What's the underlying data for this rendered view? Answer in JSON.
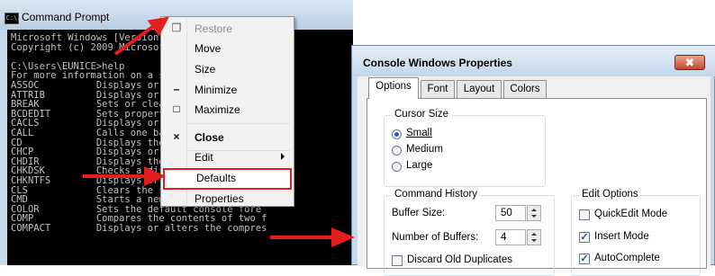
{
  "cmd": {
    "title": "Command Prompt",
    "icon": "cmd-icon",
    "lines": [
      "Microsoft Windows [Version 6.1.7600]",
      "Copyright (c) 2009 Microsoft Corporation.  Al",
      "",
      "C:\\Users\\EUNICE>help",
      "For more information on a specific command, t",
      "ASSOC          Displays or modifies file exte",
      "ATTRIB         Displays or changes file attri",
      "BREAK          Sets or clears extended CTRL+C",
      "BCDEDIT        Sets properties in boot databa",
      "CACLS          Displays or modifies access co",
      "CALL           Calls one batch program from a",
      "CD             Displays the name of or change",
      "CHCP           Displays or sets the active co",
      "CHDIR          Displays the name of or change",
      "CHKDSK         Checks a disk and displays a s",
      "CHKNTFS        Displays or modifies the check",
      "CLS            Clears the screen.",
      "CMD            Starts a new instance of the W",
      "COLOR          Sets the default console fore",
      "COMP           Compares the contents of two f",
      "COMPACT        Displays or alters the compres"
    ]
  },
  "context_menu": {
    "items": [
      {
        "label": "Restore",
        "icon": "restore-icon",
        "glyph": "❐",
        "disabled": true
      },
      {
        "label": "Move"
      },
      {
        "label": "Size"
      },
      {
        "label": "Minimize",
        "icon": "minimize-icon",
        "glyph": "–"
      },
      {
        "label": "Maximize",
        "icon": "maximize-icon",
        "glyph": "□"
      },
      {
        "label": "Close",
        "icon": "close-icon",
        "glyph": "×"
      },
      {
        "label": "Edit",
        "has_submenu": true
      },
      {
        "label": "Defaults",
        "highlighted": true
      },
      {
        "label": "Properties"
      }
    ]
  },
  "properties_dialog": {
    "title": "Console Windows Properties",
    "close_glyph": "✖",
    "tabs": [
      "Options",
      "Font",
      "Layout",
      "Colors"
    ],
    "active_tab": "Options",
    "cursor_size": {
      "title": "Cursor Size",
      "options": [
        "Small",
        "Medium",
        "Large"
      ],
      "selected": "Small"
    },
    "command_history": {
      "title": "Command History",
      "buffer_size_label": "Buffer Size:",
      "buffer_size_value": "50",
      "num_buffers_label": "Number of Buffers:",
      "num_buffers_value": "4",
      "discard_label": "Discard Old Duplicates",
      "discard_checked": false
    },
    "edit_options": {
      "title": "Edit Options",
      "quickedit_label": "QuickEdit Mode",
      "quickedit_checked": false,
      "insert_label": "Insert Mode",
      "insert_checked": true,
      "autocomplete_label": "AutoComplete",
      "autocomplete_checked": true
    }
  },
  "colors": {
    "arrow": "#e21e1e",
    "console_bg": "#000000",
    "console_fg": "#c0c0c0"
  }
}
